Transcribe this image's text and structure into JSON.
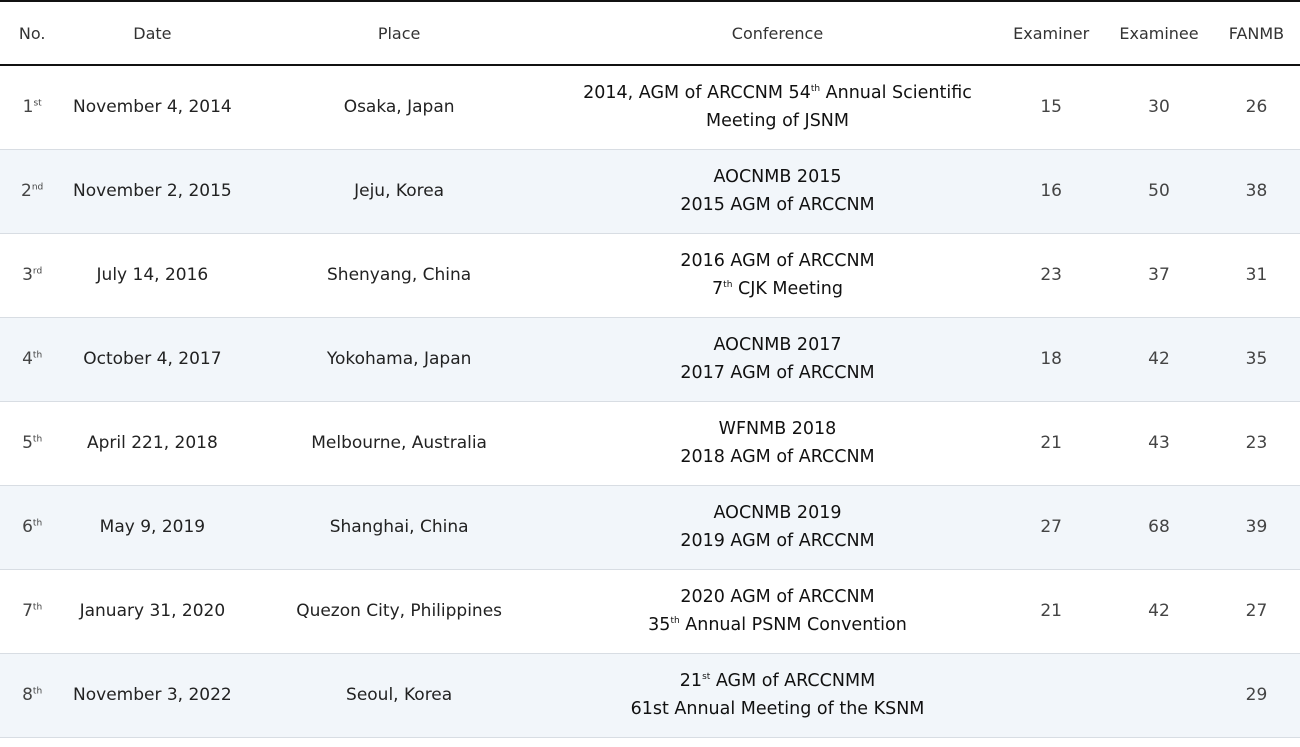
{
  "headers": {
    "no": "No.",
    "date": "Date",
    "place": "Place",
    "conference": "Conference",
    "examiner": "Examiner",
    "examinee": "Examinee",
    "fanmb": "FANMB"
  },
  "rows": [
    {
      "no": "1",
      "no_sup": "st",
      "date": "November 4, 2014",
      "place": "Osaka, Japan",
      "conf1_a": "2014, AGM of ARCCNM 54",
      "conf1_sup": "th",
      "conf1_b": " Annual Scientific",
      "conf2_a": "Meeting of JSNM",
      "conf2_sup": "",
      "conf2_b": "",
      "examiner": "15",
      "examinee": "30",
      "fanmb": "26"
    },
    {
      "no": "2",
      "no_sup": "nd",
      "date": "November 2, 2015",
      "place": "Jeju, Korea",
      "conf1_a": "AOCNMB 2015",
      "conf1_sup": "",
      "conf1_b": "",
      "conf2_a": "2015 AGM of ARCCNM",
      "conf2_sup": "",
      "conf2_b": "",
      "examiner": "16",
      "examinee": "50",
      "fanmb": "38"
    },
    {
      "no": "3",
      "no_sup": "rd",
      "date": "July 14, 2016",
      "place": "Shenyang, China",
      "conf1_a": "2016 AGM of ARCCNM",
      "conf1_sup": "",
      "conf1_b": "",
      "conf2_a": "7",
      "conf2_sup": "th",
      "conf2_b": " CJK Meeting",
      "examiner": "23",
      "examinee": "37",
      "fanmb": "31"
    },
    {
      "no": "4",
      "no_sup": "th",
      "date": "October 4, 2017",
      "place": "Yokohama, Japan",
      "conf1_a": "AOCNMB 2017",
      "conf1_sup": "",
      "conf1_b": "",
      "conf2_a": "2017 AGM of ARCCNM",
      "conf2_sup": "",
      "conf2_b": "",
      "examiner": "18",
      "examinee": "42",
      "fanmb": "35"
    },
    {
      "no": "5",
      "no_sup": "th",
      "date": "April 221, 2018",
      "place": "Melbourne, Australia",
      "conf1_a": "WFNMB 2018",
      "conf1_sup": "",
      "conf1_b": "",
      "conf2_a": "2018 AGM of ARCCNM",
      "conf2_sup": "",
      "conf2_b": "",
      "examiner": "21",
      "examinee": "43",
      "fanmb": "23"
    },
    {
      "no": "6",
      "no_sup": "th",
      "date": "May 9, 2019",
      "place": "Shanghai, China",
      "conf1_a": "AOCNMB 2019",
      "conf1_sup": "",
      "conf1_b": "",
      "conf2_a": "2019 AGM of ARCCNM",
      "conf2_sup": "",
      "conf2_b": "",
      "examiner": "27",
      "examinee": "68",
      "fanmb": "39"
    },
    {
      "no": "7",
      "no_sup": "th",
      "date": "January 31, 2020",
      "place": "Quezon City, Philippines",
      "conf1_a": "2020 AGM of ARCCNM",
      "conf1_sup": "",
      "conf1_b": "",
      "conf2_a": "35",
      "conf2_sup": "th",
      "conf2_b": " Annual PSNM Convention",
      "examiner": "21",
      "examinee": "42",
      "fanmb": "27"
    },
    {
      "no": "8",
      "no_sup": "th",
      "date": "November 3, 2022",
      "place": "Seoul, Korea",
      "conf1_a": "21",
      "conf1_sup": "st",
      "conf1_b": " AGM of ARCCNMM",
      "conf2_a": "61st Annual Meeting of the KSNM",
      "conf2_sup": "",
      "conf2_b": "",
      "examiner": "",
      "examinee": "",
      "fanmb": "29"
    }
  ]
}
